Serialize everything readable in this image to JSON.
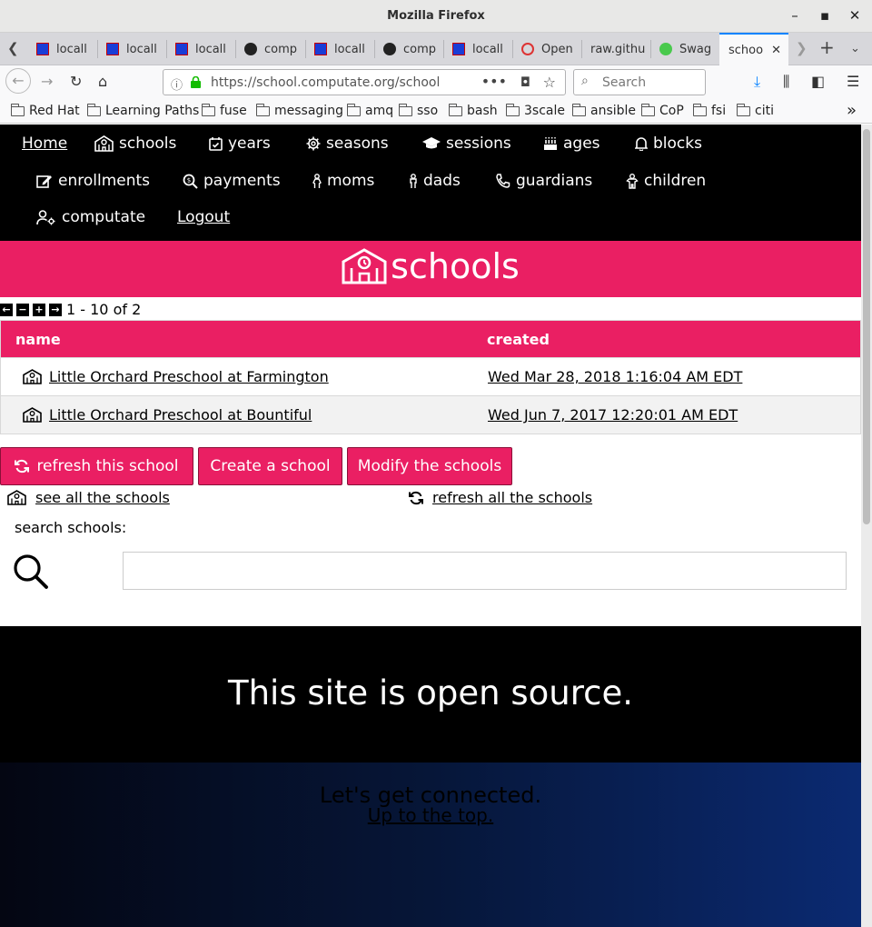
{
  "window": {
    "title": "Mozilla Firefox"
  },
  "tabs": [
    {
      "label": "locall",
      "favicon": "jenkins-icon"
    },
    {
      "label": "locall",
      "favicon": "jenkins-icon"
    },
    {
      "label": "locall",
      "favicon": "jenkins-icon"
    },
    {
      "label": "comp",
      "favicon": "github-icon"
    },
    {
      "label": "locall",
      "favicon": "jenkins-icon"
    },
    {
      "label": "comp",
      "favicon": "github-icon"
    },
    {
      "label": "locall",
      "favicon": "jenkins-icon"
    },
    {
      "label": "Open",
      "favicon": "openshift-icon"
    },
    {
      "label": "raw.githu",
      "favicon": ""
    },
    {
      "label": "Swag",
      "favicon": "swagger-icon"
    },
    {
      "label": "schoo",
      "favicon": "",
      "active": true
    }
  ],
  "address": {
    "url": "https://school.computate.org/school"
  },
  "search": {
    "placeholder": "Search"
  },
  "bookmarks": [
    "Red Hat",
    "Learning Paths",
    "fuse",
    "messaging",
    "amq",
    "sso",
    "bash",
    "3scale",
    "ansible",
    "CoP",
    "fsi",
    "citi"
  ],
  "nav": {
    "home": "Home",
    "schools": "schools",
    "years": "years",
    "seasons": "seasons",
    "sessions": "sessions",
    "ages": "ages",
    "blocks": "blocks",
    "enrollments": "enrollments",
    "payments": "payments",
    "moms": "moms",
    "dads": "dads",
    "guardians": "guardians",
    "children": "children",
    "computate": "computate",
    "logout": "Logout"
  },
  "banner": {
    "title": "schools"
  },
  "pager": {
    "text": "1 - 10 of 2"
  },
  "table": {
    "headers": {
      "name": "name",
      "created": "created"
    },
    "rows": [
      {
        "name": "Little Orchard Preschool at Farmington",
        "created": "Wed Mar 28, 2018 1:16:04 AM EDT"
      },
      {
        "name": "Little Orchard Preschool at Bountiful",
        "created": "Wed Jun 7, 2017 12:20:01 AM EDT"
      }
    ]
  },
  "actions": {
    "refresh": "refresh this school",
    "create": "Create a school",
    "modify": "Modify the schools"
  },
  "links": {
    "see_all": "see all the schools",
    "refresh_all": "refresh all the schools"
  },
  "search_section": {
    "label": "search schools:",
    "value": ""
  },
  "footer": {
    "open_source": "This site is open source.",
    "connect": "Let's get connected.",
    "top": "Up to the top."
  }
}
